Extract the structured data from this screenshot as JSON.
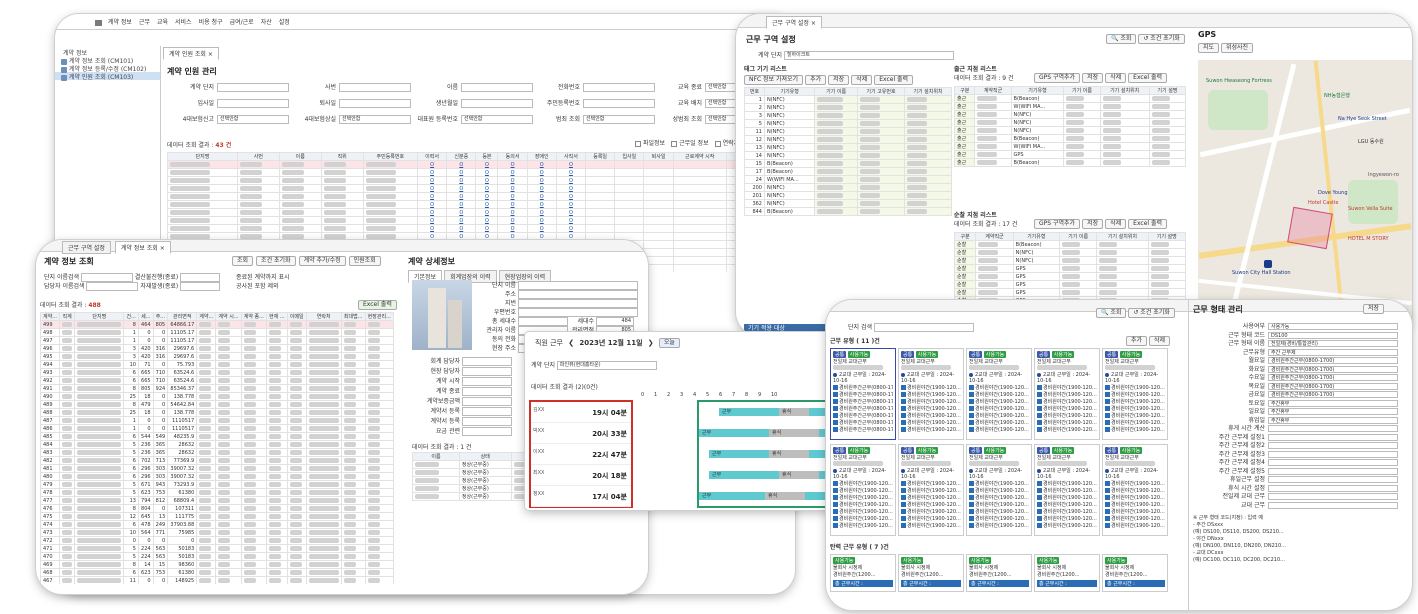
{
  "main": {
    "menu": [
      "계약 정보",
      "근무",
      "교육",
      "서비스",
      "비용 청구",
      "급여/근로",
      "자산",
      "설정"
    ],
    "tree": [
      "계약 정보",
      "계약 정보 조회 (CM101)",
      "계약 정보 등록/수정 (CM102)",
      "계약 인원 조회 (CM103)"
    ],
    "tabs": [
      "계약 인원 조회"
    ],
    "page_title": "계약 인원 관리",
    "filters_row1": [
      "계약 단지",
      "사번",
      "이름",
      "전화번호",
      "교육 종료"
    ],
    "filters_row2": [
      "입사일",
      "퇴사일",
      "생년월일",
      "주민등록번호",
      "교육 배치"
    ],
    "filters_row3": [
      "4대보험신고",
      "4대보험상실",
      "대표원 등록번호",
      "범죄 조회",
      "성범죄 조회"
    ],
    "select_value": "선택안함",
    "result_label": "데이터 조회 결과 :",
    "result_count": "43 건",
    "checkboxes": [
      "파일정보",
      "근무일 정보",
      "연락처",
      "급여"
    ],
    "columns": [
      "단지명",
      "사번",
      "이름",
      "직위",
      "주민등록번호",
      "이력서",
      "신분증",
      "등본",
      "동의서",
      "장애인",
      "사직서",
      "등록일",
      "입사일",
      "퇴사일",
      "근로계약 시작",
      "근로계약 종료",
      "연"
    ],
    "link_o": "O"
  },
  "device": {
    "tabs": [
      "근무 구역 설정"
    ],
    "title": "근무 구역 설정",
    "complex_label": "계약 단지",
    "complex_value": "힐하이크트",
    "search": "조회",
    "reset": "조건 초기화",
    "tag_list_title": "태그 기기 리스트",
    "tag_toolbar": [
      "NFC 정보 가져오기",
      "추가",
      "저장",
      "삭제",
      "Excel 출력"
    ],
    "tag_columns": [
      "번호",
      "기기유형",
      "기기 이름",
      "기기 고유번호",
      "기기 설치위치"
    ],
    "tag_rows": [
      [
        "1",
        "N(NFC)"
      ],
      [
        "2",
        "N(NFC)"
      ],
      [
        "3",
        "N(NFC)"
      ],
      [
        "5",
        "N(NFC)"
      ],
      [
        "11",
        "N(NFC)"
      ],
      [
        "12",
        "N(NFC)"
      ],
      [
        "13",
        "N(NFC)"
      ],
      [
        "14",
        "N(NFC)"
      ],
      [
        "15",
        "B(Beacon)"
      ],
      [
        "17",
        "B(Beacon)"
      ],
      [
        "24",
        "W(WIFI MA..."
      ],
      [
        "200",
        "N(NFC)"
      ],
      [
        "201",
        "N(NFC)"
      ],
      [
        "362",
        "N(NFC)"
      ],
      [
        "844",
        "B(Beacon)"
      ]
    ],
    "gate_title": "출근 지점 리스트",
    "gate_result": "데이터 조회 결과 : 9 건",
    "gate_toolbar": [
      "GPS 구역추가",
      "저장",
      "삭제",
      "Excel 출력"
    ],
    "gate_columns": [
      "구분",
      "계약직군",
      "기기유형",
      "기기 이름",
      "기기 설치위치",
      "기기 설명"
    ],
    "gate_rows": [
      [
        "출근",
        "B(Beacon)"
      ],
      [
        "출근",
        "W(WIFI MA..."
      ],
      [
        "출근",
        "N(NFC)"
      ],
      [
        "출근",
        "N(NFC)"
      ],
      [
        "출근",
        "N(NFC)"
      ],
      [
        "출근",
        "B(Beacon)"
      ],
      [
        "출근",
        "W(WIFI MA..."
      ],
      [
        "출근",
        "GPS"
      ],
      [
        "출근",
        "B(Beacon)"
      ]
    ],
    "patrol_title": "순찰 지점 리스트",
    "patrol_result": "데이터 조회 결과 : 17 건",
    "patrol_rows": [
      [
        "순찰",
        "B(Beacon)"
      ],
      [
        "순찰",
        "N(NFC)"
      ],
      [
        "순찰",
        "N(NFC)"
      ],
      [
        "순찰",
        "GPS"
      ],
      [
        "순찰",
        "GPS"
      ],
      [
        "순찰",
        "GPS"
      ],
      [
        "순찰",
        "GPS"
      ],
      [
        "순찰",
        "GPS"
      ],
      [
        "순찰",
        "GPS"
      ]
    ],
    "footer": "기기 적용 대상",
    "gps_title": "GPS",
    "map_buttons": [
      "지도",
      "위성사진"
    ],
    "map_labels": [
      {
        "text": "Suwon Hwaseong Fortress",
        "color": "#1a7a3a"
      },
      {
        "text": "Suwon City Hall Station",
        "color": "#1a3a8a"
      },
      {
        "text": "HOTEL M STORY",
        "color": "#c0392b"
      },
      {
        "text": "Suwon Vella Suite",
        "color": "#c0392b"
      },
      {
        "text": "LGU 동수원",
        "color": "#333"
      },
      {
        "text": "Na Hye Seok Street",
        "color": "#1a3a8a"
      },
      {
        "text": "Hotel Castle",
        "color": "#c0392b"
      },
      {
        "text": "Dove Young",
        "color": "#1a3a8a"
      },
      {
        "text": "NH농협은행",
        "color": "#1a7a3a"
      },
      {
        "text": "Ingyewon-ro",
        "color": "#555"
      }
    ]
  },
  "store": {
    "tabs": [
      "근무 구역 설정",
      "계약 정보 조회"
    ],
    "title": "계약 정보 조회",
    "toolbar": [
      "조회",
      "조건 초기화",
      "계약 추가/수정",
      "인원조회"
    ],
    "filters": [
      "단지 이름검색",
      "담당자 이름검색",
      "결산불진행(종료)",
      "자재발생(종료)"
    ],
    "checks": [
      "종료된 계약까지 표시",
      "공사된 포함 제외"
    ],
    "result_label": "데이터 조회 결과 :",
    "result_count": "488",
    "excel": "Excel 출력",
    "columns": [
      "계약...",
      "직계",
      "단지명",
      "건...",
      "세...",
      "주...",
      "관리면적",
      "계약...",
      "계약 시...",
      "계약 종...",
      "현재 ...",
      "이메일",
      "연락처",
      "최대법...",
      "현장관리..."
    ],
    "rows": [
      [
        "499",
        "8",
        "464",
        "805",
        "64866.17"
      ],
      [
        "498",
        "1",
        "0",
        "0",
        "11105.17"
      ],
      [
        "497",
        "1",
        "0",
        "0",
        "11105.17"
      ],
      [
        "496",
        "3",
        "420",
        "316",
        "29697.6"
      ],
      [
        "495",
        "3",
        "420",
        "316",
        "29697.6"
      ],
      [
        "494",
        "10",
        "71",
        "0",
        "75.793"
      ],
      [
        "493",
        "6",
        "665",
        "710",
        "63524.6"
      ],
      [
        "492",
        "6",
        "665",
        "710",
        "63524.6"
      ],
      [
        "491",
        "8",
        "805",
        "924",
        "85346.37"
      ],
      [
        "490",
        "25",
        "18",
        "0",
        "138.778"
      ],
      [
        "489",
        "8",
        "479",
        "0",
        "54642.84"
      ],
      [
        "488",
        "25",
        "18",
        "0",
        "138.778"
      ],
      [
        "487",
        "1",
        "0",
        "0",
        "1110517"
      ],
      [
        "486",
        "1",
        "0",
        "0",
        "1110517"
      ],
      [
        "485",
        "6",
        "544",
        "549",
        "48235.9"
      ],
      [
        "484",
        "5",
        "236",
        "365",
        "28632"
      ],
      [
        "483",
        "5",
        "236",
        "365",
        "28632"
      ],
      [
        "482",
        "6",
        "702",
        "713",
        "77369.9"
      ],
      [
        "481",
        "6",
        "296",
        "303",
        "39007.32"
      ],
      [
        "480",
        "6",
        "296",
        "303",
        "39007.32"
      ],
      [
        "479",
        "5",
        "671",
        "943",
        "73293.9"
      ],
      [
        "478",
        "5",
        "623",
        "753",
        "61380"
      ],
      [
        "477",
        "13",
        "794",
        "812",
        "68809.4"
      ],
      [
        "476",
        "8",
        "804",
        "0",
        "107311"
      ],
      [
        "475",
        "12",
        "645",
        "13",
        "111775"
      ],
      [
        "474",
        "6",
        "478",
        "249",
        "37903.88"
      ],
      [
        "473",
        "10",
        "564",
        "771",
        "75985"
      ],
      [
        "472",
        "0",
        "0",
        "0",
        "0"
      ],
      [
        "471",
        "5",
        "224",
        "563",
        "50183"
      ],
      [
        "470",
        "5",
        "224",
        "563",
        "50183"
      ],
      [
        "469",
        "8",
        "14",
        "15",
        "98360"
      ],
      [
        "468",
        "6",
        "623",
        "753",
        "61380"
      ],
      [
        "467",
        "11",
        "0",
        "0",
        "148925"
      ],
      [
        "466",
        "6",
        "417",
        "480",
        "44200"
      ]
    ],
    "detail_title": "계약 상세정보",
    "detail_tabs": [
      "기본정보",
      "회계업장의 이력",
      "현장업장의 이력"
    ],
    "detail_fields": [
      "단지 이름",
      "주소",
      "지번",
      "우편번호",
      "총 세대수",
      "관리자 이름",
      "동의 전화",
      "현장 주소"
    ],
    "detail_values": [
      "",
      "",
      "",
      "",
      "",
      "",
      "",
      ""
    ],
    "right_fields": [
      "건물수",
      "세대수",
      "관리면적",
      "전체면적"
    ],
    "right_values": [
      "0",
      "484",
      "805",
      "64,866.17"
    ],
    "left_fields": [
      "회계 담당자",
      "현장 담당자",
      "계약 시작",
      "계약 종료",
      "계약보증금액",
      "계약서 등록",
      "계약서 등록",
      "요금 관련"
    ],
    "bottom_result": "데이터 조회 결과 : 1 건",
    "bottom_columns": [
      "이름",
      "상태",
      "입사일"
    ],
    "bottom_rows": [
      "정상(근무중)",
      "정상(근무중)",
      "정상(근무중)",
      "정상(근무중)",
      "정상(근무중)"
    ]
  },
  "gantt": {
    "title": "직원 근무",
    "date": "2023년 12월 11일",
    "today": "오늘",
    "complex_label": "계약 단지",
    "complex_value": "파인뷰(현대홈타운)",
    "result": "데이터 조회 결과 (2)(0건)",
    "hours": [
      "0",
      "1",
      "2",
      "3",
      "4",
      "5",
      "6",
      "7",
      "8",
      "9",
      "10"
    ],
    "people": [
      {
        "name": "김XX",
        "time": "19시 04분"
      },
      {
        "name": "박XX",
        "time": "20시 33분"
      },
      {
        "name": "이XX",
        "time": "22시 47분"
      },
      {
        "name": "최XX",
        "time": "20시 18분"
      },
      {
        "name": "정XX",
        "time": "17시 04분"
      }
    ],
    "bar_work": "근무",
    "bar_break": "휴식",
    "bar_color_work": "#5ec9cf",
    "bar_color_break": "#bdbdbd"
  },
  "shift": {
    "tabs": [
      "근무 형태 관리"
    ],
    "complex_label": "단지 검색",
    "search": "조회",
    "reset": "조건 초기화",
    "group1_title": "근무 유형 ( 11 )건",
    "add": "추가",
    "del": "삭제",
    "card_tag": "공통",
    "card_status": "사용가능",
    "card_kind": "전일제 교대근무",
    "card_days": "2교대 근무일 : 2024-10-16",
    "card_line": "경비원주간근무(0800-17...",
    "card_line2": "경비원야간(1900-120...",
    "group2_title": "탄력 근무 유형 ( 7 )건",
    "flex_tag": "사용가능",
    "flex_line": "물회사 시정제",
    "flex_line2": "경비원주간(1200...",
    "flex_foot": "총 근무시간 :",
    "detail_title": "근무 형태 관리",
    "save": "저장",
    "fields": [
      "사용여부",
      "근무 형태 코드",
      "근무 형태 이름",
      "근무유형",
      "월요일",
      "화요일",
      "수요일",
      "목요일",
      "금요일",
      "토요일",
      "일요일",
      "휴업일",
      "휴게 시간 계산",
      "주간 근무제 설정1",
      "주간 근무제 설정2",
      "주간 근무제 설정3",
      "주간 근무제 설정4",
      "주간 근무제 설정5",
      "휴일근무 설정",
      "휴식 시간 설정",
      "전일제 교대 근무",
      "교대 근무"
    ],
    "values": [
      "사용가능",
      "DS100",
      "전일제(경비/통합관리)",
      "주간 근무제",
      "경비원주간근무(0800-1700)",
      "경비원주간근무(0800-1700)",
      "경비원주간근무(0800-1700)",
      "경비원주간근무(0800-1700)",
      "경비원주간근무(0800-1700)",
      "주간휴무",
      "주간휴무",
      "주간휴무",
      "",
      "",
      "",
      "",
      "",
      "",
      "",
      "",
      "",
      ""
    ],
    "notes": [
      "※ 근무 형태 코드(지정) : 입력 예",
      "- 주간 DSxxx",
      "(예) DS100, DS110, DS200, DS210...",
      "- 야간 DNxxx",
      "(예) DN100, DN110, DN200, DN210...",
      "- 교대 DCxxx",
      "(예) DC100, DC110, DC200, DC210..."
    ]
  }
}
